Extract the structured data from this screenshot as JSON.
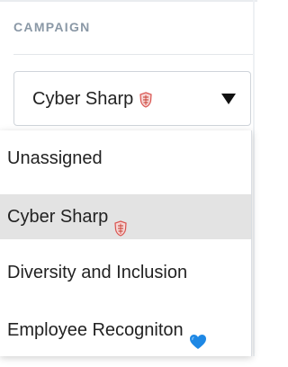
{
  "section": {
    "label": "CAMPAIGN"
  },
  "select": {
    "value": "Cyber Sharp",
    "value_icon": "shield-icon",
    "toggle_icon": "caret-down-icon"
  },
  "dropdown": {
    "options": [
      {
        "label": "Unassigned",
        "icon": null,
        "selected": false
      },
      {
        "label": "Cyber Sharp",
        "icon": "shield-icon",
        "selected": true
      },
      {
        "label": "Diversity and Inclusion",
        "icon": null,
        "selected": false
      },
      {
        "label": "Employee Recogniton",
        "icon": "blue-heart-icon",
        "selected": false
      }
    ]
  },
  "colors": {
    "label_text": "#8a98a6",
    "text": "#222222",
    "selected_bg": "#e3e3e3",
    "border": "#cfd4da",
    "shield_red": "#d9534f",
    "heart_blue": "#1e88e5"
  }
}
